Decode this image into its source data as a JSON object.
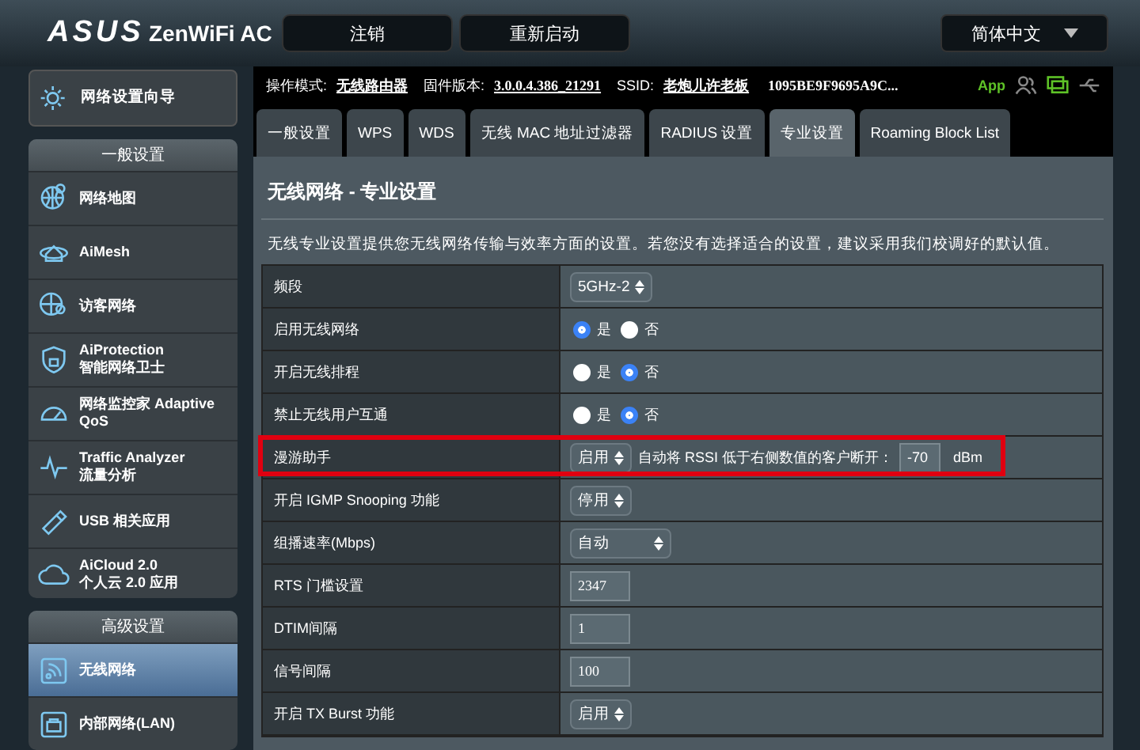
{
  "header": {
    "brand": "ASUS",
    "product": "ZenWiFi AC",
    "buttons": [
      "注销",
      "重新启动"
    ],
    "language": "简体中文"
  },
  "sidebar": {
    "wizard": "网络设置向导",
    "sections": [
      {
        "title": "一般设置",
        "items": [
          {
            "label": "网络地图",
            "selected": false
          },
          {
            "label": "AiMesh",
            "selected": false
          },
          {
            "label": "访客网络",
            "selected": false
          },
          {
            "label": "AiProtection",
            "sub": "智能网络卫士",
            "selected": false
          },
          {
            "label": "网络监控家 Adaptive QoS",
            "selected": false
          },
          {
            "label": "Traffic Analyzer",
            "sub": "流量分析",
            "selected": false
          },
          {
            "label": "USB 相关应用",
            "selected": false
          },
          {
            "label": "AiCloud 2.0",
            "sub": "个人云 2.0 应用",
            "selected": false
          }
        ]
      },
      {
        "title": "高级设置",
        "items": [
          {
            "label": "无线网络",
            "selected": true
          },
          {
            "label": "内部网络(LAN)",
            "selected": false
          }
        ]
      }
    ]
  },
  "info": {
    "mode_label": "操作模式:",
    "mode": "无线路由器",
    "firmware_label": "固件版本:",
    "firmware": "3.0.0.4.386_21291",
    "ssid_label": "SSID:",
    "ssid": "老炮儿许老板",
    "ssid2": "1095BE9F9695A9C...",
    "app": "App"
  },
  "tabs": [
    {
      "label": "一般设置",
      "selected": false
    },
    {
      "label": "WPS",
      "selected": false
    },
    {
      "label": "WDS",
      "selected": false
    },
    {
      "label": "无线 MAC 地址过滤器",
      "selected": false
    },
    {
      "label": "RADIUS 设置",
      "selected": false
    },
    {
      "label": "专业设置",
      "selected": true
    },
    {
      "label": "Roaming Block List",
      "selected": false
    }
  ],
  "panel": {
    "title": "无线网络 - 专业设置",
    "description": "无线专业设置提供您无线网络传输与效率方面的设置。若您没有选择适合的设置，建议采用我们校调好的默认值。",
    "rows": [
      {
        "kind": "select",
        "label": "频段",
        "value": "5GHz-2",
        "highlighted": false
      },
      {
        "kind": "radio",
        "label": "启用无线网络",
        "options": [
          {
            "label": "是",
            "selected": true
          },
          {
            "label": "否",
            "selected": false
          }
        ],
        "highlighted": false
      },
      {
        "kind": "radio",
        "label": "开启无线排程",
        "options": [
          {
            "label": "是",
            "selected": false
          },
          {
            "label": "否",
            "selected": true
          }
        ],
        "highlighted": false
      },
      {
        "kind": "radio",
        "label": "禁止无线用户互通",
        "options": [
          {
            "label": "是",
            "selected": false
          },
          {
            "label": "否",
            "selected": true
          }
        ],
        "highlighted": false
      },
      {
        "kind": "roaming",
        "label": "漫游助手",
        "value": "启用",
        "text": "自动将 RSSI 低于右侧数值的客户断开：",
        "input": "-70",
        "unit": "dBm",
        "highlighted": true
      },
      {
        "kind": "select",
        "label": "开启 IGMP Snooping 功能",
        "value": "停用",
        "highlighted": false
      },
      {
        "kind": "wide-select",
        "label": "组播速率(Mbps)",
        "value": "自动",
        "highlighted": false
      },
      {
        "kind": "input",
        "label": "RTS 门槛设置",
        "value": "2347",
        "highlighted": false
      },
      {
        "kind": "input",
        "label": "DTIM间隔",
        "value": "1",
        "highlighted": false
      },
      {
        "kind": "input",
        "label": "信号间隔",
        "value": "100",
        "highlighted": false
      },
      {
        "kind": "select",
        "label": "开启 TX Burst 功能",
        "value": "启用",
        "highlighted": false
      }
    ]
  }
}
